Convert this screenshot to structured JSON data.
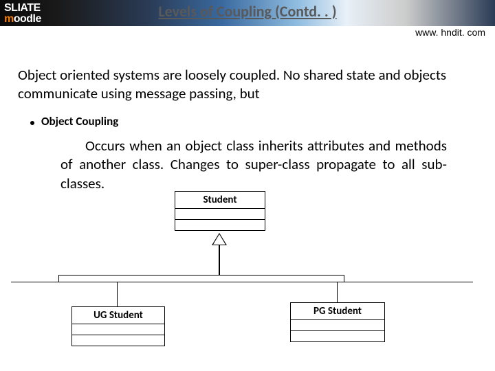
{
  "banner": {
    "brand_prefix": "SLIATE",
    "brand_word_pre": "",
    "brand_m": "m",
    "brand_word_post": "oodle",
    "title": "Levels of Coupling   (Contd. . )"
  },
  "url": "www. hndit. com",
  "intro": "Object oriented systems are loosely coupled. No shared state and objects communicate using message passing, but",
  "bullet": {
    "label": "Object Coupling"
  },
  "desc": "Occurs when an object class inherits attributes and methods of another class.   Changes to super-class propagate to all sub-classes.",
  "uml": {
    "parent": "Student",
    "childL": "UG Student",
    "childR": "PG Student"
  }
}
